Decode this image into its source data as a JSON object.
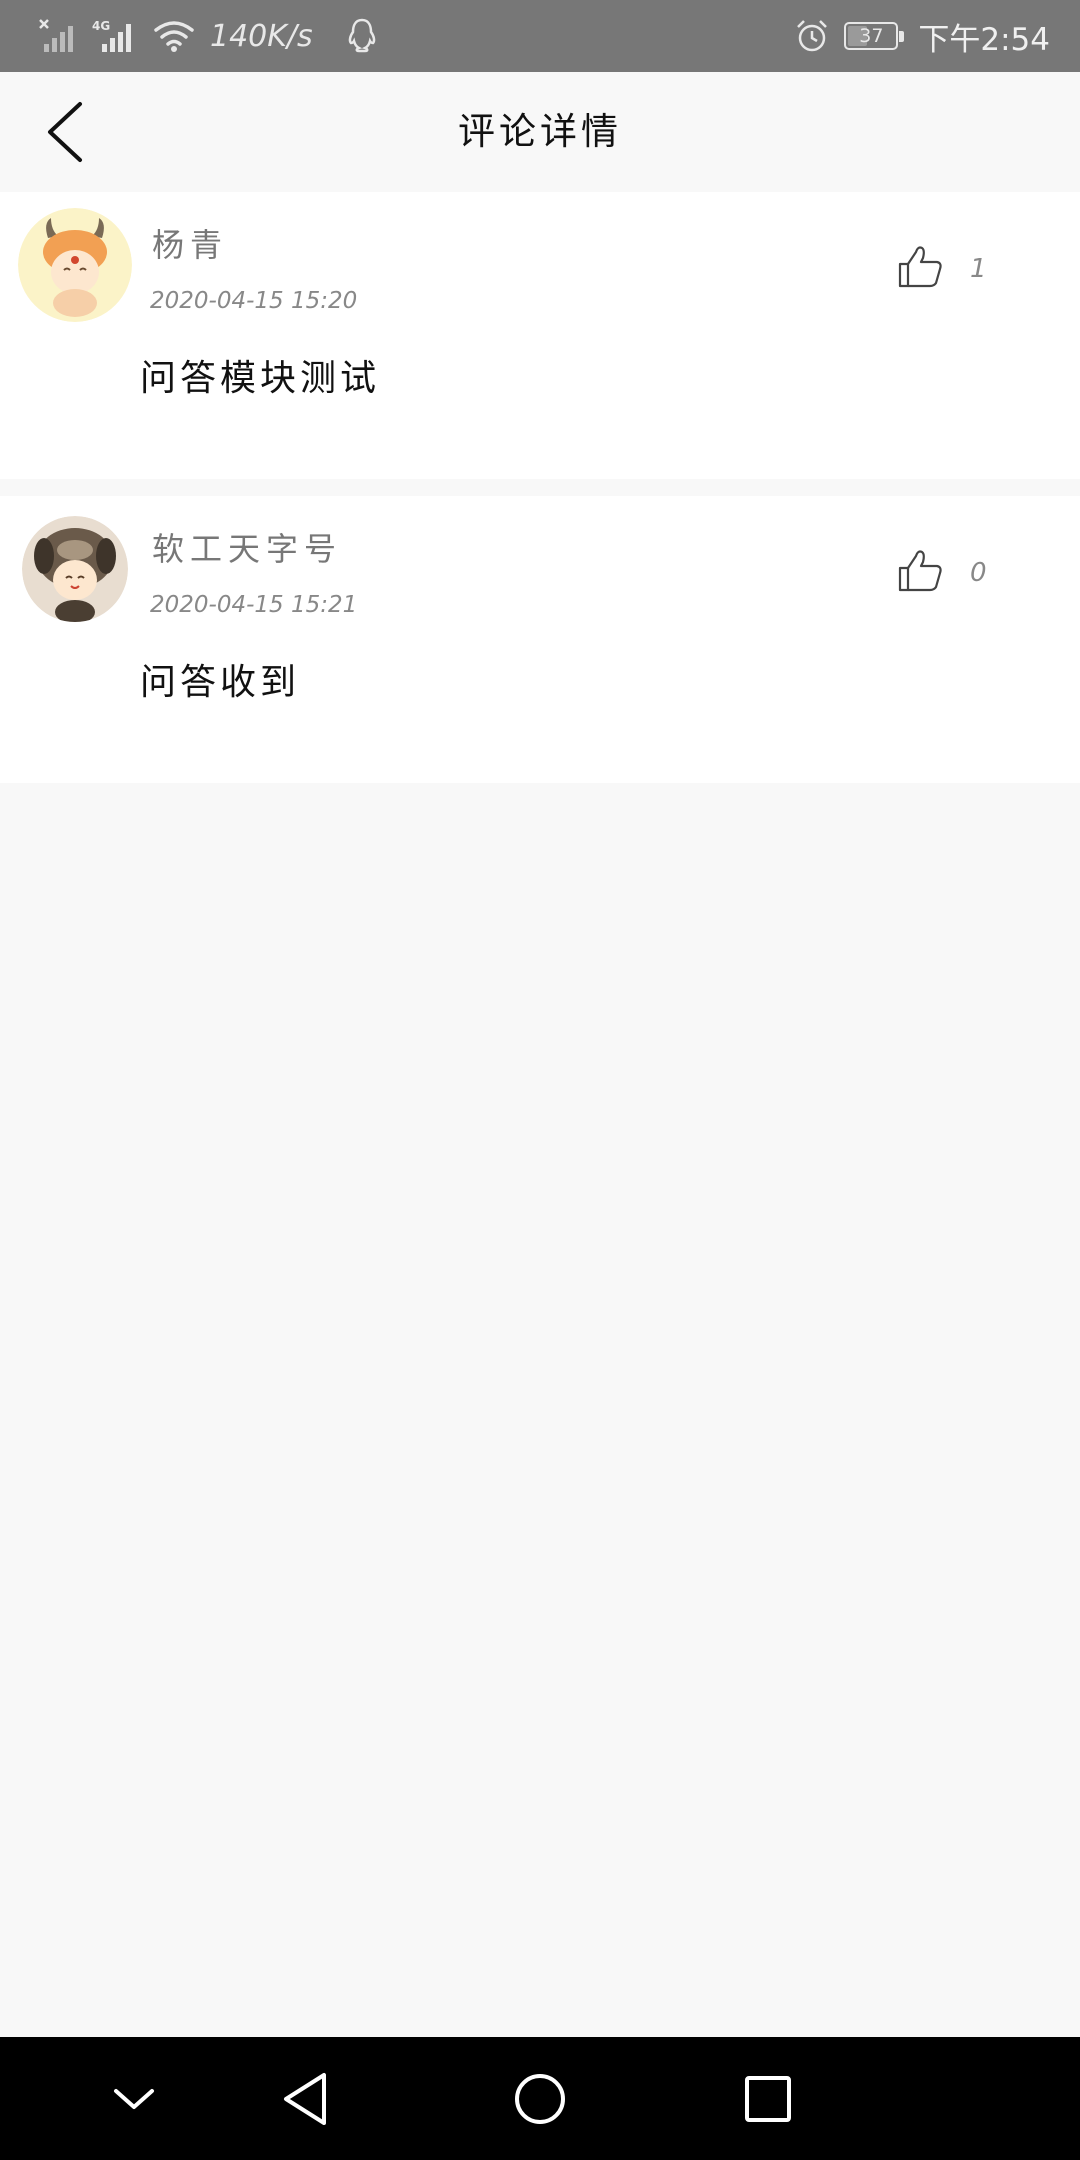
{
  "status_bar": {
    "network_speed": "140K/s",
    "battery_level": "37",
    "time": "下午2:54",
    "icons": [
      "no-sim-signal-icon",
      "4g-signal-icon",
      "wifi-icon",
      "qq-icon",
      "alarm-icon",
      "battery-icon"
    ]
  },
  "header": {
    "title": "评论详情",
    "back_icon": "chevron-left-icon"
  },
  "comments": [
    {
      "username": "杨青",
      "timestamp": "2020-04-15 15:20",
      "content": "问答模块测试",
      "like_count": "1",
      "avatar_icon": "avatar-orange-horned"
    },
    {
      "username": "软工天字号",
      "timestamp": "2020-04-15 15:21",
      "content": "问答收到",
      "like_count": "0",
      "avatar_icon": "avatar-dog-hood"
    }
  ],
  "nav_bar": {
    "icons": [
      "collapse-icon",
      "back-triangle-icon",
      "home-circle-icon",
      "recents-square-icon"
    ]
  },
  "colors": {
    "status_bar_bg": "#777777",
    "page_bg": "#f8f8f8",
    "card_bg": "#ffffff",
    "nav_bar_bg": "#000000"
  }
}
